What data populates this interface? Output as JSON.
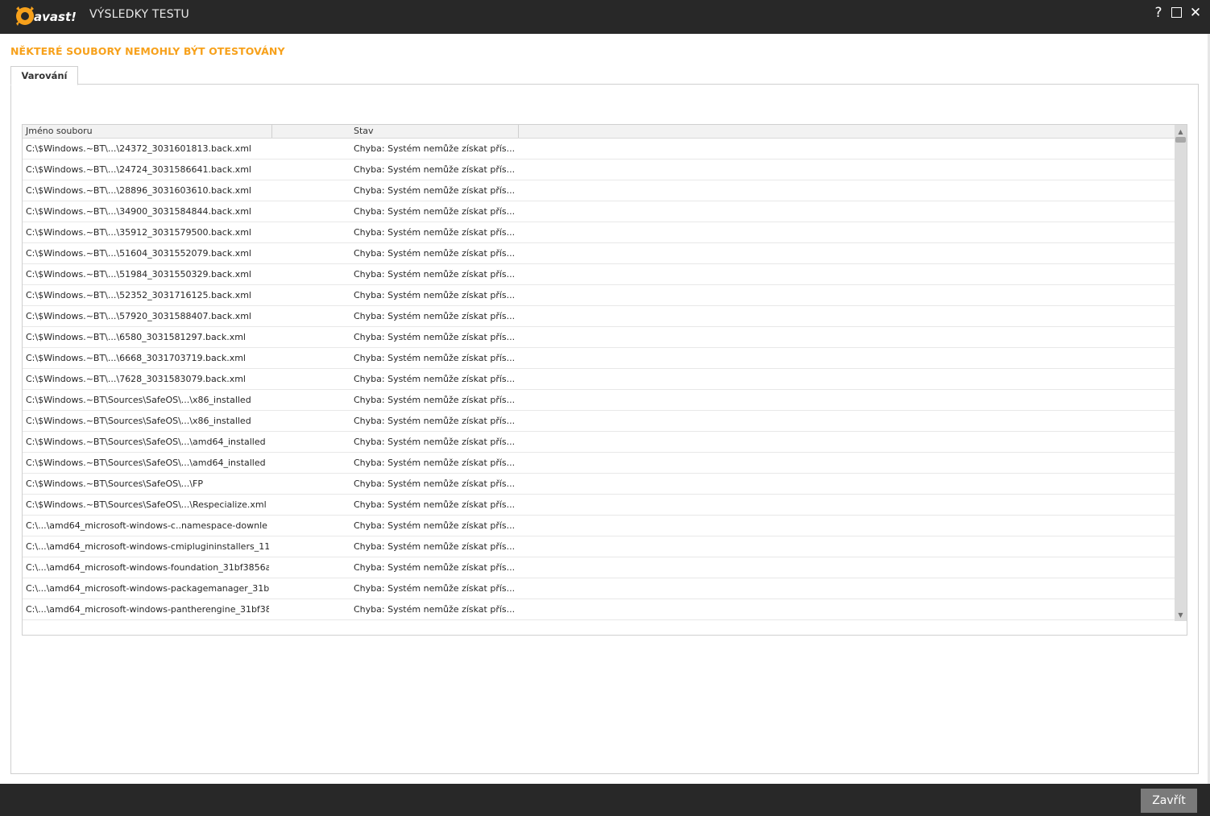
{
  "window": {
    "brand": "avast!",
    "title": "VÝSLEDKY TESTU",
    "help_glyph": "?",
    "close_glyph": "✕"
  },
  "heading": "NĚKTERÉ SOUBORY NEMOHLY BÝT OTESTOVÁNY",
  "tabs": [
    {
      "label": "Varování",
      "active": true
    }
  ],
  "table": {
    "columns": [
      "Jméno souboru",
      "Stav"
    ],
    "rows": [
      {
        "name": "C:\\$Windows.~BT\\...\\24372_3031601813.back.xml",
        "status": "Chyba: Systém nemůže získat přís..."
      },
      {
        "name": "C:\\$Windows.~BT\\...\\24724_3031586641.back.xml",
        "status": "Chyba: Systém nemůže získat přís..."
      },
      {
        "name": "C:\\$Windows.~BT\\...\\28896_3031603610.back.xml",
        "status": "Chyba: Systém nemůže získat přís..."
      },
      {
        "name": "C:\\$Windows.~BT\\...\\34900_3031584844.back.xml",
        "status": "Chyba: Systém nemůže získat přís..."
      },
      {
        "name": "C:\\$Windows.~BT\\...\\35912_3031579500.back.xml",
        "status": "Chyba: Systém nemůže získat přís..."
      },
      {
        "name": "C:\\$Windows.~BT\\...\\51604_3031552079.back.xml",
        "status": "Chyba: Systém nemůže získat přís..."
      },
      {
        "name": "C:\\$Windows.~BT\\...\\51984_3031550329.back.xml",
        "status": "Chyba: Systém nemůže získat přís..."
      },
      {
        "name": "C:\\$Windows.~BT\\...\\52352_3031716125.back.xml",
        "status": "Chyba: Systém nemůže získat přís..."
      },
      {
        "name": "C:\\$Windows.~BT\\...\\57920_3031588407.back.xml",
        "status": "Chyba: Systém nemůže získat přís..."
      },
      {
        "name": "C:\\$Windows.~BT\\...\\6580_3031581297.back.xml",
        "status": "Chyba: Systém nemůže získat přís..."
      },
      {
        "name": "C:\\$Windows.~BT\\...\\6668_3031703719.back.xml",
        "status": "Chyba: Systém nemůže získat přís..."
      },
      {
        "name": "C:\\$Windows.~BT\\...\\7628_3031583079.back.xml",
        "status": "Chyba: Systém nemůže získat přís..."
      },
      {
        "name": "C:\\$Windows.~BT\\Sources\\SafeOS\\...\\x86_installed",
        "status": "Chyba: Systém nemůže získat přís..."
      },
      {
        "name": "C:\\$Windows.~BT\\Sources\\SafeOS\\...\\x86_installed",
        "status": "Chyba: Systém nemůže získat přís..."
      },
      {
        "name": "C:\\$Windows.~BT\\Sources\\SafeOS\\...\\amd64_installed",
        "status": "Chyba: Systém nemůže získat přís..."
      },
      {
        "name": "C:\\$Windows.~BT\\Sources\\SafeOS\\...\\amd64_installed",
        "status": "Chyba: Systém nemůže získat přís..."
      },
      {
        "name": "C:\\$Windows.~BT\\Sources\\SafeOS\\...\\FP",
        "status": "Chyba: Systém nemůže získat přís..."
      },
      {
        "name": "C:\\$Windows.~BT\\Sources\\SafeOS\\...\\Respecialize.xml",
        "status": "Chyba: Systém nemůže získat přís..."
      },
      {
        "name": "C:\\...\\amd64_microsoft-windows-c..namespace-downle",
        "status": "Chyba: Systém nemůže získat přís..."
      },
      {
        "name": "C:\\...\\amd64_microsoft-windows-cmiplugininstallers_11",
        "status": "Chyba: Systém nemůže získat přís..."
      },
      {
        "name": "C:\\...\\amd64_microsoft-windows-foundation_31bf3856a",
        "status": "Chyba: Systém nemůže získat přís..."
      },
      {
        "name": "C:\\...\\amd64_microsoft-windows-packagemanager_31b",
        "status": "Chyba: Systém nemůže získat přís..."
      },
      {
        "name": "C:\\...\\amd64_microsoft-windows-pantherengine_31bf38",
        "status": "Chyba: Systém nemůže získat přís..."
      }
    ]
  },
  "footer": {
    "close_label": "Zavřít"
  },
  "colors": {
    "accent": "#f7a11b",
    "titlebar": "#282828",
    "button": "#7a7a7a"
  },
  "icons": {
    "help": "help-icon",
    "maximize": "maximize-icon",
    "close": "close-icon",
    "scroll_up": "scroll-up-arrow-icon",
    "scroll_down": "scroll-down-arrow-icon"
  }
}
